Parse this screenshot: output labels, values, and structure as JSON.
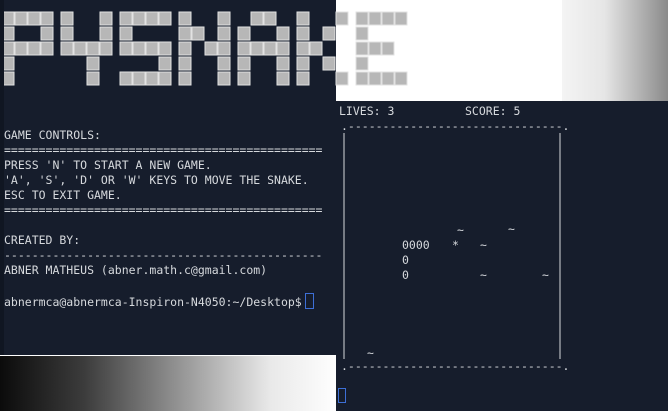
{
  "left_terminal": {
    "logo_text": "PYSNAKE",
    "controls_header": "GAME CONTROLS:",
    "separator_double": "==============================================",
    "controls": [
      "PRESS 'N' TO START A NEW GAME.",
      "'A', 'S', 'D' OR 'W' KEYS TO MOVE THE SNAKE.",
      "ESC TO EXIT GAME."
    ],
    "created_header": "CREATED BY:",
    "separator_dash": "----------------------------------------------",
    "author": "ABNER MATHEUS (abner.math.c@gmail.com)",
    "prompt": "abnermca@abnermca-Inspiron-N4050:~/Desktop$"
  },
  "game_terminal": {
    "lives_label": "LIVES: 3",
    "score_label": "SCORE: 5",
    "border_top": ".-------------------------------.",
    "border_bottom": ".-------------------------------.",
    "grid_cells": {
      "tilde1": "~",
      "tilde2": "~",
      "row1_body": "0000",
      "food": "*",
      "tilde3": "~",
      "row2_body": "0",
      "row3_body": "0",
      "tilde4": "~",
      "tilde5": "~",
      "tilde6": "~"
    }
  },
  "colors": {
    "terminal_bg": "#161d2c",
    "terminal_text": "#d6d9dd",
    "cursor": "#3d6fd6"
  }
}
